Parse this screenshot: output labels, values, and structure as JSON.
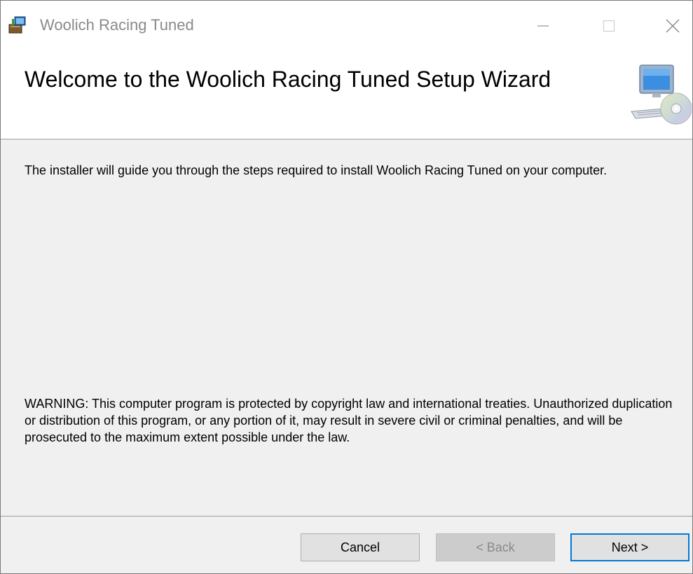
{
  "window": {
    "title": "Woolich Racing Tuned",
    "controls": {
      "minimize_icon": "minimize-icon",
      "maximize_icon": "maximize-icon",
      "close_icon": "close-icon"
    }
  },
  "header": {
    "heading": "Welcome to the Woolich Racing Tuned Setup Wizard",
    "icon": "computer-cd-icon"
  },
  "body": {
    "intro": "The installer will guide you through the steps required to install Woolich Racing Tuned on your computer.",
    "warning": "WARNING: This computer program is protected by copyright law and international treaties. Unauthorized duplication or distribution of this program, or any portion of it, may result in severe civil or criminal penalties, and will be prosecuted to the maximum extent possible under the law."
  },
  "buttons": {
    "cancel": "Cancel",
    "back": "< Back",
    "next": "Next >"
  },
  "colors": {
    "accent": "#0078d7",
    "background": "#f0f0f0",
    "disabled_text": "#8a8a8a"
  }
}
